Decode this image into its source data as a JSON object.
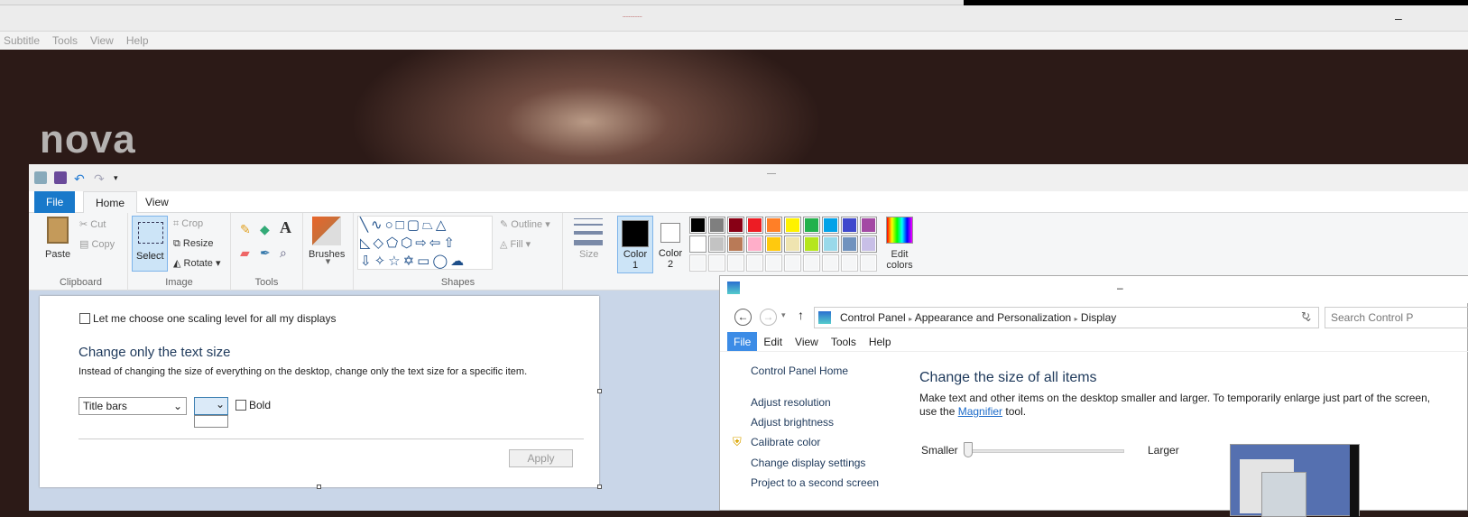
{
  "player": {
    "title": "-------------",
    "minimize": "–",
    "menu": [
      "Subtitle",
      "Tools",
      "View",
      "Help"
    ],
    "logo": "nova"
  },
  "paint": {
    "title": "-----",
    "tabs": {
      "file": "File",
      "home": "Home",
      "view": "View"
    },
    "clipboard": {
      "paste": "Paste",
      "cut": "Cut",
      "copy": "Copy",
      "label": "Clipboard"
    },
    "image": {
      "select": "Select",
      "crop": "Crop",
      "resize": "Resize",
      "rotate": "Rotate",
      "label": "Image"
    },
    "tools": {
      "label": "Tools"
    },
    "brushes": {
      "label": "Brushes"
    },
    "shapes": {
      "outline": "Outline",
      "fill": "Fill",
      "label": "Shapes"
    },
    "size": {
      "label": "Size"
    },
    "colors": {
      "color1": "Color",
      "color1_n": "1",
      "color2": "Color",
      "color2_n": "2",
      "edit": "Edit colors",
      "palette": [
        "#000000",
        "#7f7f7f",
        "#880015",
        "#ed1c24",
        "#ff7f27",
        "#fff200",
        "#22b14c",
        "#00a2e8",
        "#3f48cc",
        "#a349a4",
        "#ffffff",
        "#c3c3c3",
        "#b97a57",
        "#ffaec9",
        "#ffc90e",
        "#efe4b0",
        "#b5e61d",
        "#99d9ea",
        "#7092be",
        "#c8bfe7"
      ]
    },
    "canvas": {
      "checkbox_label": "Let me choose one scaling level for all my displays",
      "heading": "Change only the text size",
      "desc": "Instead of changing the size of everything on the desktop, change only the text size for a specific item.",
      "item_select": "Title bars",
      "bold": "Bold",
      "apply": "Apply"
    }
  },
  "control_panel": {
    "title": "–",
    "breadcrumb": [
      "Control Panel",
      "Appearance and Personalization",
      "Display"
    ],
    "search_placeholder": "Search Control P",
    "menu": [
      "File",
      "Edit",
      "View",
      "Tools",
      "Help"
    ],
    "sidebar": [
      "Control Panel Home",
      "Adjust resolution",
      "Adjust brightness",
      "Calibrate color",
      "Change display settings",
      "Project to a second screen"
    ],
    "heading": "Change the size of all items",
    "desc1": "Make text and other items on the desktop smaller and larger. To temporarily enlarge just part of the screen,",
    "desc2_pre": "use the ",
    "desc2_link": "Magnifier",
    "desc2_post": " tool.",
    "slider": {
      "min_label": "Smaller",
      "max_label": "Larger",
      "value": 0
    }
  }
}
